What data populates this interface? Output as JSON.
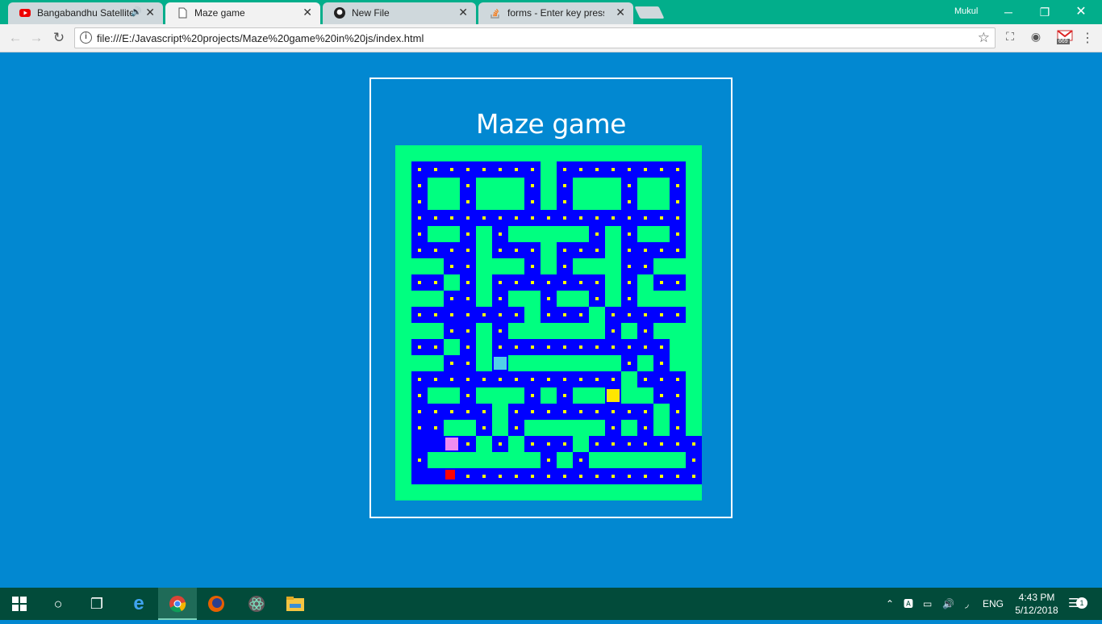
{
  "browser": {
    "tabs": [
      {
        "title": "Bangabandhu Satellite",
        "icon": "youtube-icon",
        "audio": true,
        "active": false
      },
      {
        "title": "Maze game",
        "icon": "page-icon",
        "active": true
      },
      {
        "title": "New File",
        "icon": "github-icon",
        "active": false
      },
      {
        "title": "forms - Enter key press e",
        "icon": "stackoverflow-icon",
        "active": false
      }
    ],
    "profile_name": "Mukul",
    "url": "file:///E:/Javascript%20projects/Maze%20game%20in%20js/index.html",
    "gmail_badge": "669"
  },
  "page": {
    "title": "Maze game"
  },
  "game": {
    "colors": {
      "wall": "#00ff80",
      "floor": "#0000ff",
      "pellet": "#ffff00",
      "player": "#ff0000",
      "ghost_yellow": "#ffe600",
      "ghost_pink": "#f08cf0",
      "ghost_cyan": "#50d0e8",
      "background": "#0288d1"
    },
    "grid_legend": {
      "#": "wall",
      ".": "pellet",
      " ": "empty floor",
      "P": "player (red)",
      "Y": "yellow ghost",
      "K": "pink ghost",
      "C": "cyan ghost"
    },
    "grid": [
      "###################",
      "#........#........#",
      "#.##.###.#.###.##.#",
      "#.##.###.#.###.##.#",
      "#.................#",
      "#.##.#.#####.#.##.#",
      "#....#...#...#....#",
      "###..###.#.###..###",
      "#..#.#.......#.#..#",
      "###..#.##.##.#.####",
      "#.......#...#.....#",
      "###..#.######.#.###",
      "#..#.#...........##",
      "###..#C#######.#.##",
      "#.............#...#",
      "#.##.###.#.##Y##..#",
      "#.....#.........#.#",
      "#..##.#.#####.#.#.#",
      "#  K.#.#...#........#",
      "#.#######.#.######.#",
      "#  P...............#",
      "###################"
    ]
  },
  "taskbar": {
    "apps": [
      "windows-start-icon",
      "cortana-icon",
      "task-view-icon",
      "edge-icon",
      "chrome-icon",
      "firefox-icon",
      "atom-icon",
      "file-explorer-icon"
    ],
    "language": "ENG",
    "time": "4:43 PM",
    "date": "5/12/2018",
    "notification_count": "1"
  }
}
